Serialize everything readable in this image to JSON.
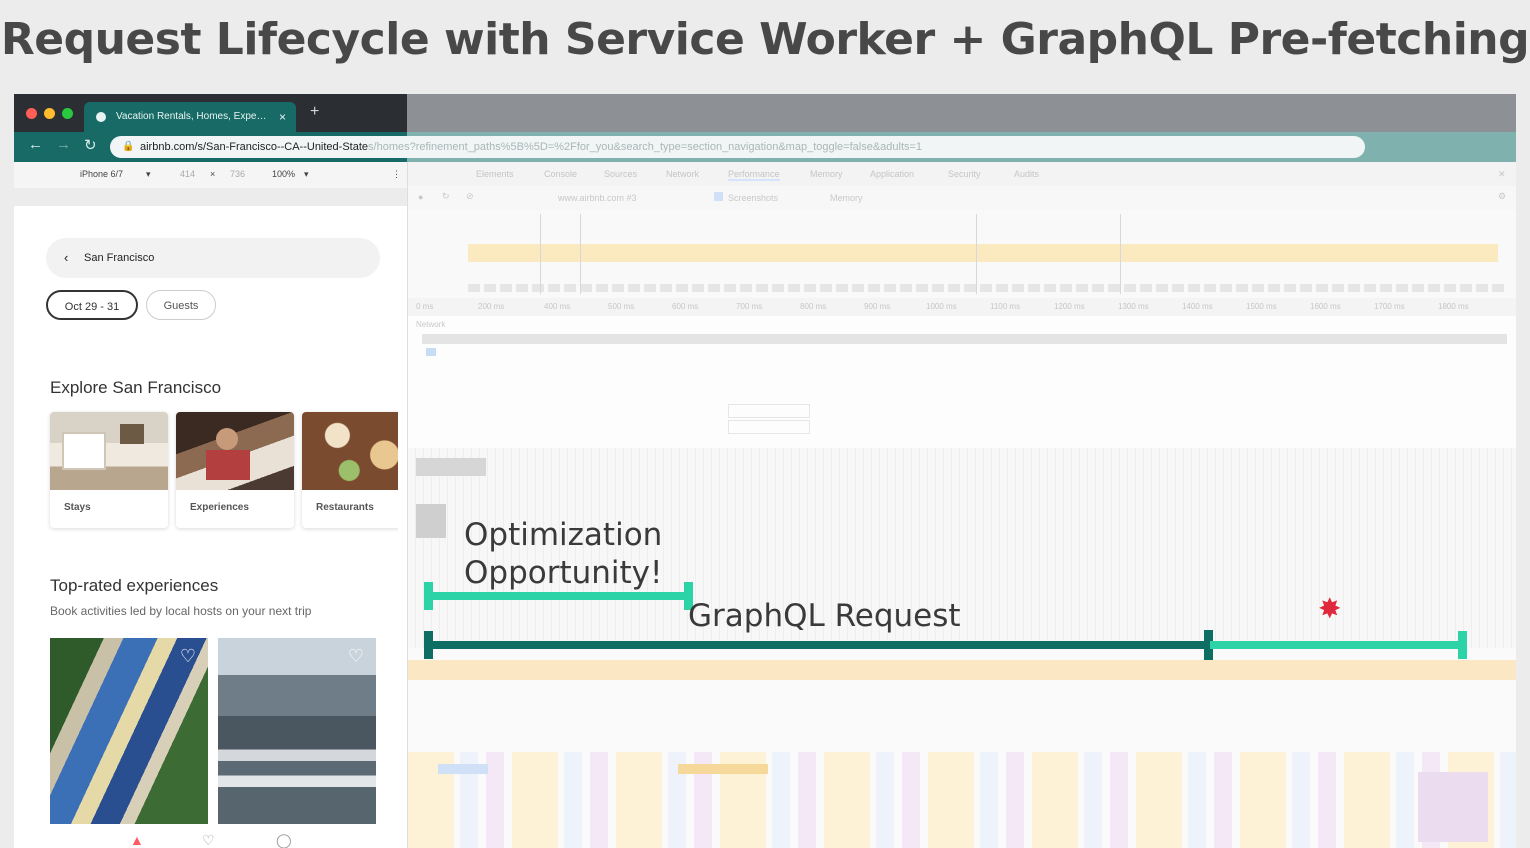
{
  "slide_title": "Request Lifecycle with Service Worker + GraphQL Pre-fetching",
  "browser": {
    "tab_title": "Vacation Rentals, Homes, Expe…",
    "tab_close": "×",
    "new_tab": "+",
    "url_visible": "airbnb.com/s/San-Francisco--CA--United-State",
    "url_faded": "s/homes?refinement_paths%5B%5D=%2Ffor_you&search_type=section_navigation&map_toggle=false&adults=1"
  },
  "device_toolbar": {
    "device": "iPhone 6/7",
    "width": "414",
    "times": "×",
    "height": "736",
    "zoom": "100%"
  },
  "airbnb": {
    "search_location": "San Francisco",
    "dates_chip": "Oct 29 - 31",
    "guests_chip": "Guests",
    "explore_heading": "Explore San Francisco",
    "categories": [
      {
        "label": "Stays"
      },
      {
        "label": "Experiences"
      },
      {
        "label": "Restaurants"
      }
    ],
    "top_rated_heading": "Top-rated experiences",
    "top_rated_sub": "Book activities led by local hosts on your next trip"
  },
  "devtools": {
    "panel_tabs": [
      "Elements",
      "Console",
      "Sources",
      "Network",
      "Performance",
      "Memory",
      "Application",
      "Security",
      "Audits"
    ],
    "toolbar_items": [
      "www.airbnb.com #3",
      "Screenshots",
      "Memory"
    ],
    "ruler_ticks": [
      "0 ms",
      "200 ms",
      "400 ms",
      "500 ms",
      "600 ms",
      "700 ms",
      "800 ms",
      "900 ms",
      "1000 ms",
      "1100 ms",
      "1200 ms",
      "1300 ms",
      "1400 ms",
      "1500 ms",
      "1600 ms",
      "1700 ms",
      "1800 ms"
    ],
    "network_label": "Network"
  },
  "annotations": {
    "optimization_line1": "Optimization",
    "optimization_line2": "Opportunity!",
    "graphql": "GraphQL Request",
    "explosion_icon": "explosion-icon"
  },
  "colors": {
    "tab_teal": "#176a66",
    "highlight_mint": "#2bd3a7",
    "request_dark": "#0f6e63",
    "explosion": "#e0283c"
  }
}
